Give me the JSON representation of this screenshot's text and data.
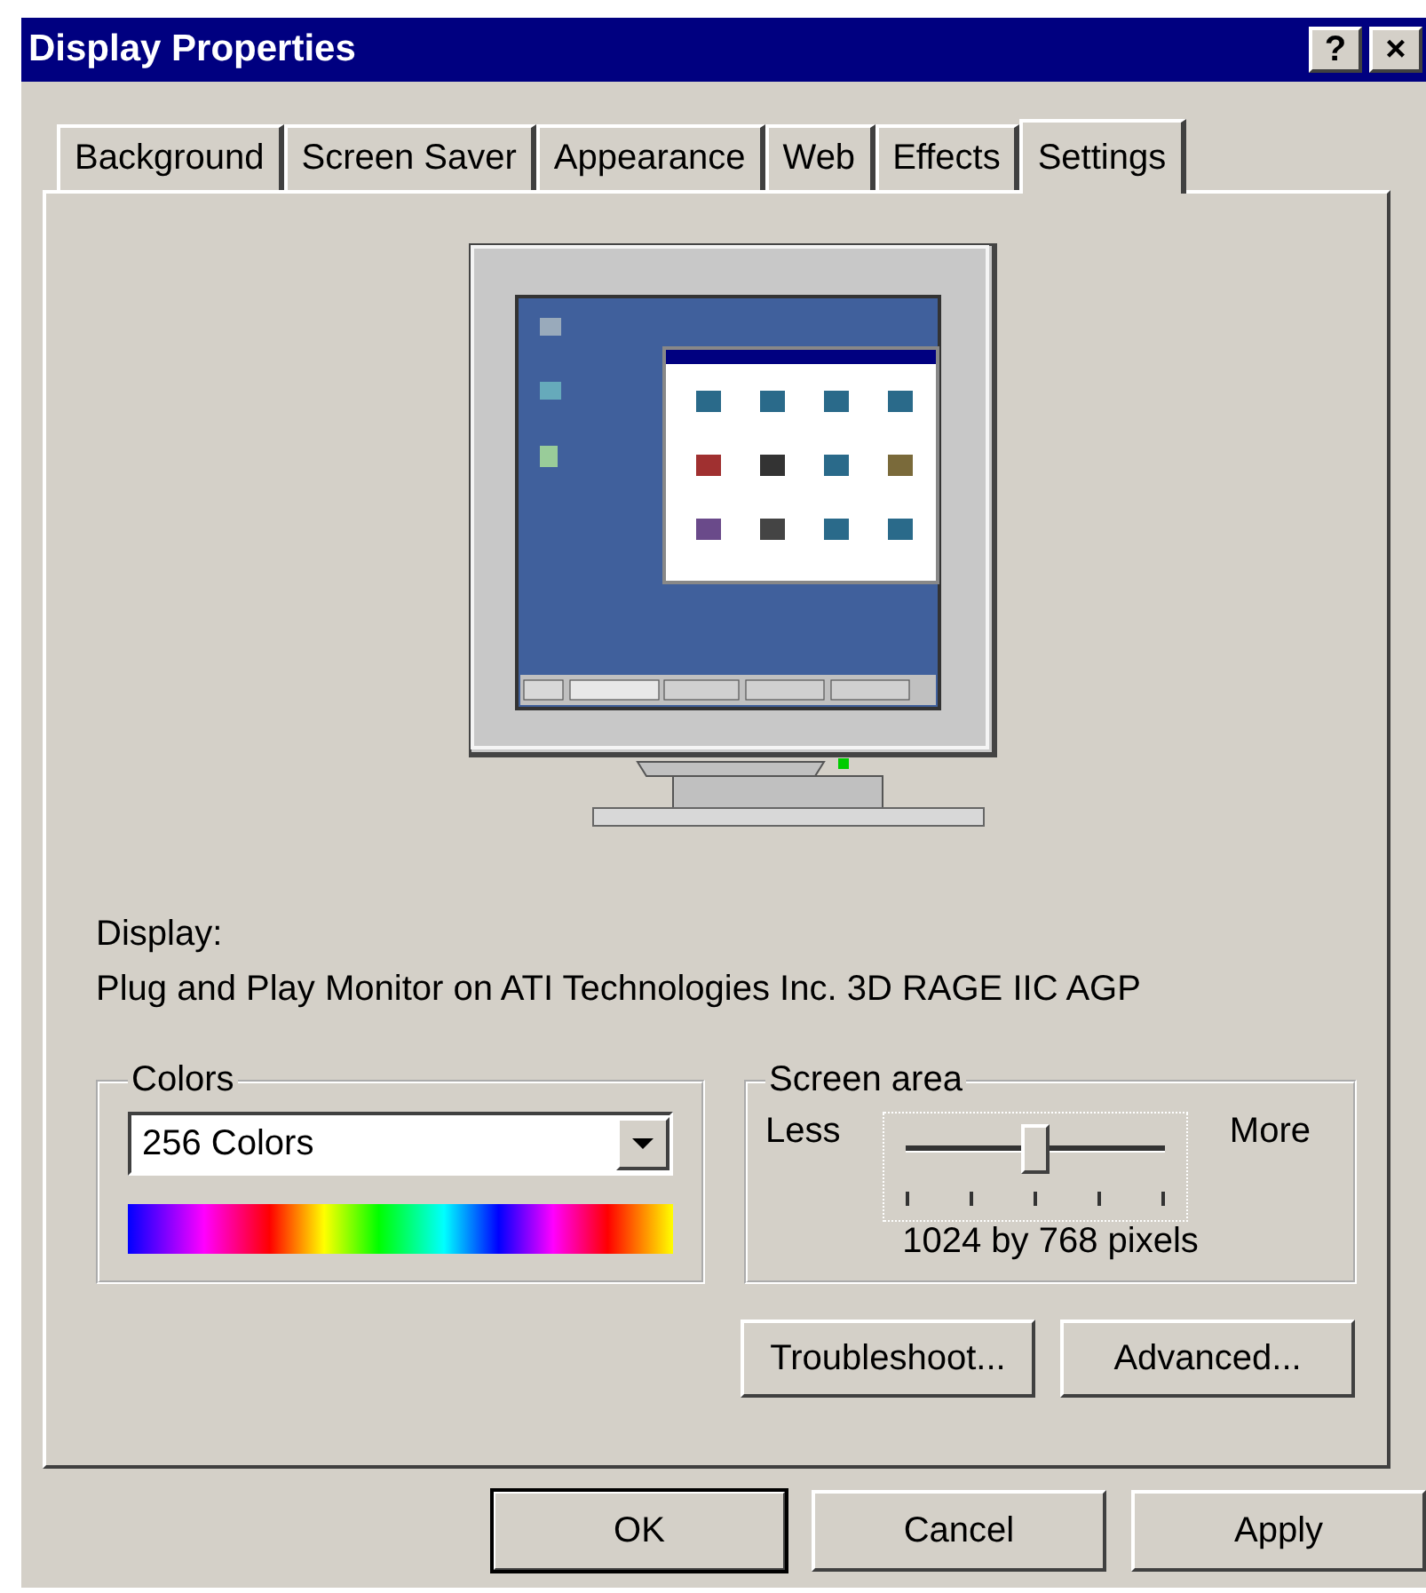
{
  "window": {
    "title": "Display Properties",
    "help_button": "?",
    "close_button": "×"
  },
  "tabs": [
    {
      "label": "Background",
      "selected": false
    },
    {
      "label": "Screen Saver",
      "selected": false
    },
    {
      "label": "Appearance",
      "selected": false
    },
    {
      "label": "Web",
      "selected": false
    },
    {
      "label": "Effects",
      "selected": false
    },
    {
      "label": "Settings",
      "selected": true
    }
  ],
  "display": {
    "label": "Display:",
    "value": "Plug and Play Monitor on ATI Technologies Inc. 3D RAGE IIC AGP"
  },
  "colors": {
    "title": "Colors",
    "value": "256 Colors"
  },
  "screen_area": {
    "title": "Screen area",
    "min_label": "Less",
    "max_label": "More",
    "level": 0.5,
    "reading": "1024 by 768 pixels"
  },
  "panel_buttons": [
    "Troubleshoot...",
    "Advanced..."
  ],
  "buttons": [
    {
      "label": "OK",
      "default": true
    },
    {
      "label": "Cancel",
      "default": false
    },
    {
      "label": "Apply",
      "default": false
    }
  ]
}
